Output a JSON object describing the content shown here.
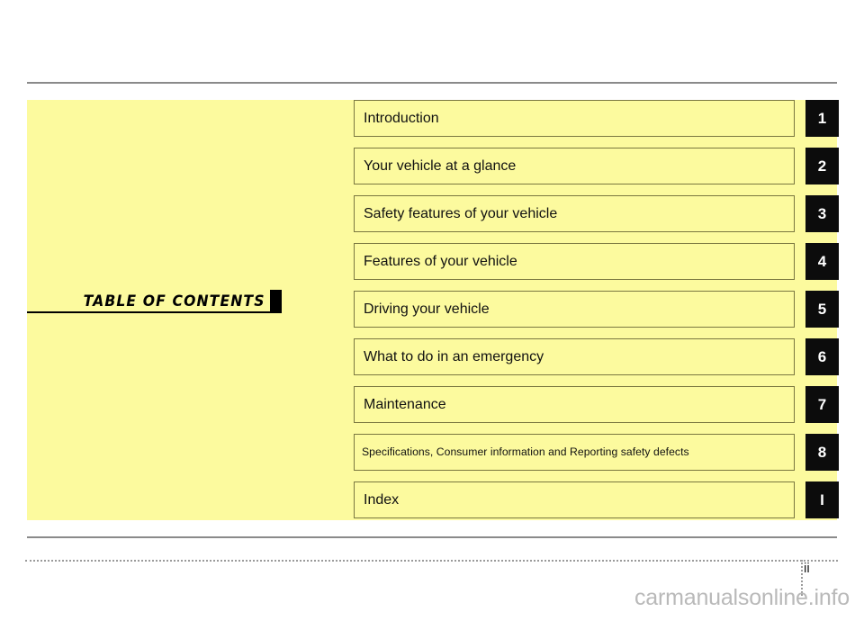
{
  "page": {
    "background_color": "#ffffff",
    "panel_color": "#fcfa9e",
    "tab_color": "#0c0c0c",
    "rule_color": "#8a8a8a"
  },
  "heading": {
    "title": "TABLE OF CONTENTS",
    "marker": ""
  },
  "contents": {
    "rows": [
      {
        "label": "Introduction",
        "tab": "1",
        "compact": false
      },
      {
        "label": "Your vehicle at a glance",
        "tab": "2",
        "compact": false
      },
      {
        "label": "Safety features of your vehicle",
        "tab": "3",
        "compact": false
      },
      {
        "label": "Features of your vehicle",
        "tab": "4",
        "compact": false
      },
      {
        "label": "Driving your vehicle",
        "tab": "5",
        "compact": false
      },
      {
        "label": "What to do in an emergency",
        "tab": "6",
        "compact": false
      },
      {
        "label": "Maintenance",
        "tab": "7",
        "compact": false
      },
      {
        "label": "Specifications, Consumer information and Reporting safety defects",
        "tab": "8",
        "compact": true
      },
      {
        "label": "Index",
        "tab": "I",
        "compact": false
      }
    ]
  },
  "footer": {
    "page_number": "ii",
    "watermark": "carmanualsonline.info"
  }
}
